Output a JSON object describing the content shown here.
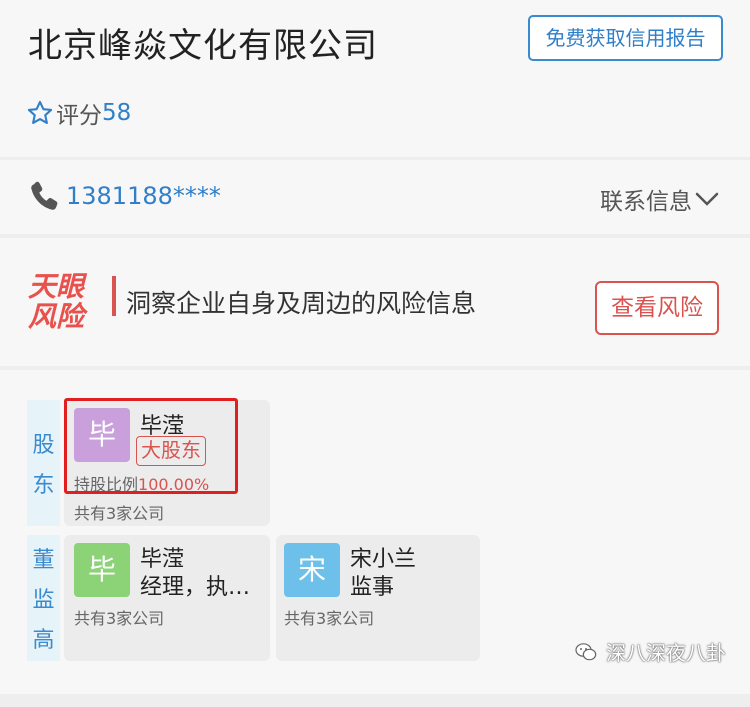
{
  "company": {
    "name": "北京峰焱文化有限公司",
    "report_button": "免费获取信用报告",
    "score_label": "评分",
    "score_value": "58"
  },
  "contact": {
    "phone": "1381188****",
    "info_label": "联系信息"
  },
  "risk": {
    "logo_text": "天眼风险",
    "description": "洞察企业自身及周边的风险信息",
    "button": "查看风险"
  },
  "shareholders": {
    "label": "股东",
    "items": [
      {
        "avatar": "毕",
        "name": "毕滢",
        "badge": "大股东",
        "ratio_label": "持股比例",
        "ratio_value": "100.00%",
        "companies": "共有3家公司",
        "avatar_color": "#c9a0dc"
      }
    ]
  },
  "executives": {
    "label": "董监高",
    "items": [
      {
        "avatar": "毕",
        "name": "毕滢",
        "role": "经理，执…",
        "companies": "共有3家公司",
        "avatar_color": "#8cd277"
      },
      {
        "avatar": "宋",
        "name": "宋小兰",
        "role": "监事",
        "companies": "共有3家公司",
        "avatar_color": "#6cc0ea"
      }
    ]
  },
  "watermark": "深八深夜八卦",
  "colors": {
    "accent_blue": "#2f7fc9",
    "risk_red": "#d9534f",
    "highlight_red": "#e02020"
  },
  "icons": [
    "star-icon",
    "phone-icon",
    "chevron-down-icon",
    "wechat-icon"
  ]
}
